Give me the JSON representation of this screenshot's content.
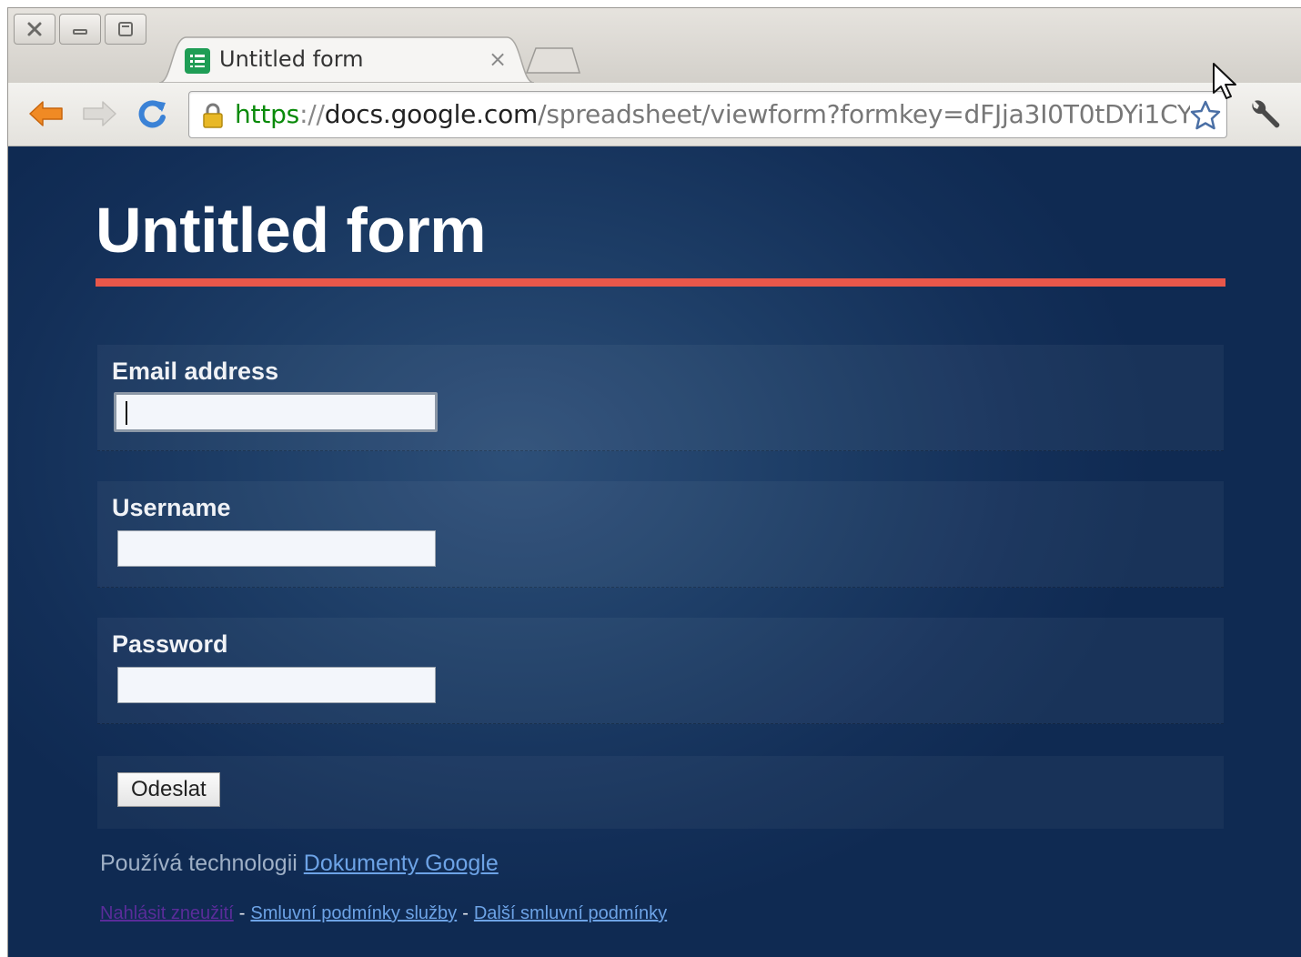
{
  "browser": {
    "tab_title": "Untitled form",
    "tab_close": "×",
    "url": {
      "scheme": "https",
      "separator": "://",
      "host": "docs.google.com",
      "path": "/spreadsheet/viewform?formkey=dFJja3I0T0tDYi1CY"
    },
    "icons": {
      "close_window": "close-icon",
      "minimize_window": "minimize-icon",
      "maximize_window": "maximize-icon",
      "favicon": "spreadsheet-icon",
      "back": "back-arrow-icon",
      "forward": "forward-arrow-icon",
      "reload": "reload-icon",
      "lock": "lock-icon",
      "bookmark": "star-icon",
      "settings": "wrench-icon"
    }
  },
  "form": {
    "title": "Untitled form",
    "questions": [
      {
        "label": "Email address",
        "value": ""
      },
      {
        "label": "Username",
        "value": ""
      },
      {
        "label": "Password",
        "value": ""
      }
    ],
    "submit_label": "Odeslat"
  },
  "footer": {
    "powered_text": "Používá technologii ",
    "powered_link": "Dokumenty Google",
    "links": [
      "Nahlásit zneužití",
      "Smluvní podmínky služby",
      "Další smluvní podmínky"
    ],
    "separator": "-"
  },
  "colors": {
    "page_background": "#1d3d66",
    "title_rule": "#e8574a",
    "link": "#6da3e6",
    "visited_link": "#5a2c9a",
    "secure_scheme": "#0a8a0a"
  }
}
